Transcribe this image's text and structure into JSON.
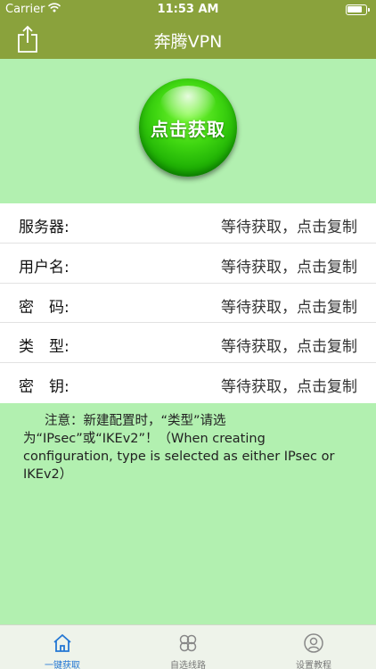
{
  "status_bar": {
    "carrier": "Carrier",
    "time": "11:53 AM"
  },
  "nav": {
    "title": "奔腾VPN"
  },
  "connect_button": {
    "label": "点击获取"
  },
  "info_rows": [
    {
      "key": "服务器:",
      "value": "等待获取，点击复制"
    },
    {
      "key": "用户名:",
      "value": "等待获取，点击复制"
    },
    {
      "key": "密　码:",
      "value": "等待获取，点击复制"
    },
    {
      "key": "类　型:",
      "value": "等待获取，点击复制"
    },
    {
      "key": "密　钥:",
      "value": "等待获取，点击复制"
    }
  ],
  "notice": "注意：新建配置时，“类型”请选为“IPsec”或“IKEv2”！（When creating configuration, type is selected as either IPsec or IKEv2）",
  "tabs": [
    {
      "label": "一键获取",
      "icon": "home-icon",
      "active": true
    },
    {
      "label": "自选线路",
      "icon": "clover-icon",
      "active": false
    },
    {
      "label": "设置教程",
      "icon": "user-circle-icon",
      "active": false
    }
  ],
  "colors": {
    "nav_bg": "#8aa23c",
    "page_bg": "#b2f0b0",
    "active_tab": "#2477d4",
    "button_green": "#3fd611"
  }
}
